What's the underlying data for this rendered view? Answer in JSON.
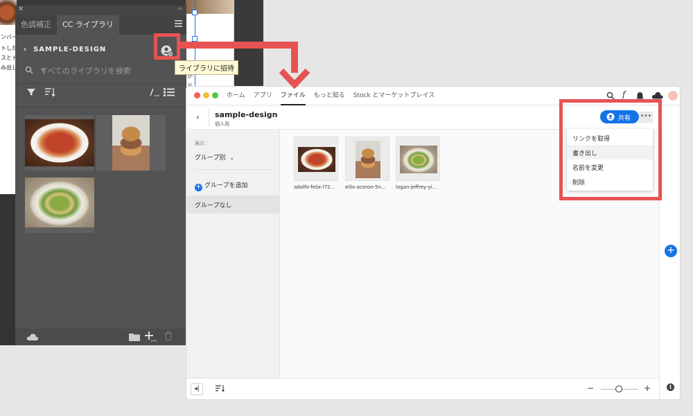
{
  "ps_panel": {
    "tabs": [
      "色調補正",
      "CC ライブラリ"
    ],
    "active_tab": 1,
    "library_name": "SAMPLE-DESIGN",
    "search_placeholder": "すべてのライブラリを検索",
    "tooltip": "ライブラリに招待"
  },
  "doc": {
    "text_lines": [
      "ンバー",
      "トした",
      "スとト",
      "み出し"
    ],
    "right_text": [
      "が",
      "ド"
    ]
  },
  "cc": {
    "nav": [
      "ホーム",
      "アプリ",
      "ファイル",
      "もっと知る",
      "Stock とマーケットプレイス"
    ],
    "active_nav": 2,
    "library_title": "sample-design",
    "library_sub": "個人用",
    "share_label": "共有",
    "more_label": "•••",
    "display_label": "表示：",
    "display_value": "グループ別",
    "add_group": "グループを追加",
    "no_group": "グループなし",
    "files": [
      {
        "name": "adolfo-felix-l72...",
        "kind": "pasta"
      },
      {
        "name": "eiliv-aceron-5n...",
        "kind": "burger"
      },
      {
        "name": "logan-jeffrey-yi...",
        "kind": "salad"
      }
    ],
    "menu": [
      "リンクを取得",
      "書き出し",
      "名前を変更",
      "削除"
    ],
    "menu_hover": 1
  },
  "colors": {
    "accent": "#1473e6",
    "callout": "#e75353",
    "panel": "#535353"
  }
}
